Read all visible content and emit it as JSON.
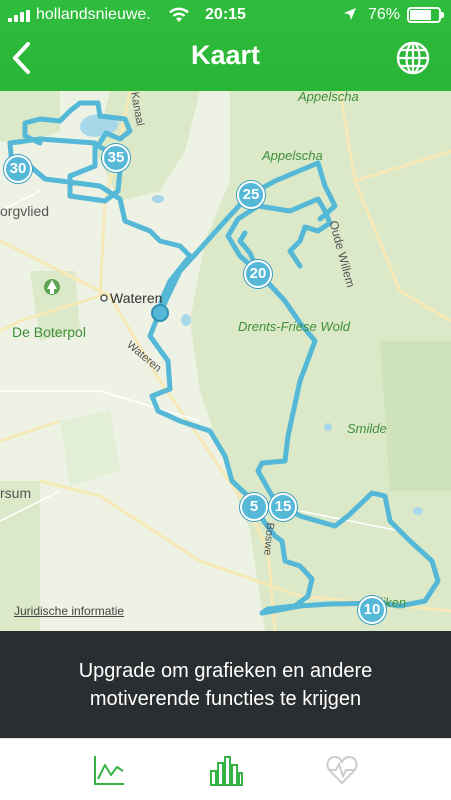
{
  "status_bar": {
    "carrier": "hollandsnieuwe.",
    "time": "20:15",
    "battery_percent": "76%",
    "battery_level": 0.76
  },
  "nav": {
    "title": "Kaart"
  },
  "map": {
    "labels": {
      "appelscha_north": "Appelscha",
      "appelscha": "Appelscha",
      "oude_willem": "Oude Willem",
      "orgvlied": "orgvlied",
      "wateren": "Wateren",
      "wateren_road": "Wateren",
      "de_boterpol": "De Boterpol",
      "drents_friese_wold": "Drents-Friese Wold",
      "smilde": "Smilde",
      "rsum": "rsum",
      "hijken": "Hijken",
      "kanaal": "Kanaal",
      "bosweg": "Boswe"
    },
    "legal": "Juridische informatie",
    "km_markers": [
      "30",
      "35",
      "25",
      "20",
      "5",
      "15",
      "10"
    ]
  },
  "upgrade": {
    "text": "Upgrade om grafieken en andere motiverende functies te krijgen"
  },
  "tabs": {
    "active": "bar-chart",
    "items": [
      "line-chart",
      "bar-chart",
      "heart-rate"
    ]
  },
  "colors": {
    "header_green": "#2fbd3d",
    "route_blue": "#55b8d6",
    "upgrade_bg": "#2b2e30",
    "tab_active": "#35b446",
    "tab_inactive": "#cccccc"
  }
}
